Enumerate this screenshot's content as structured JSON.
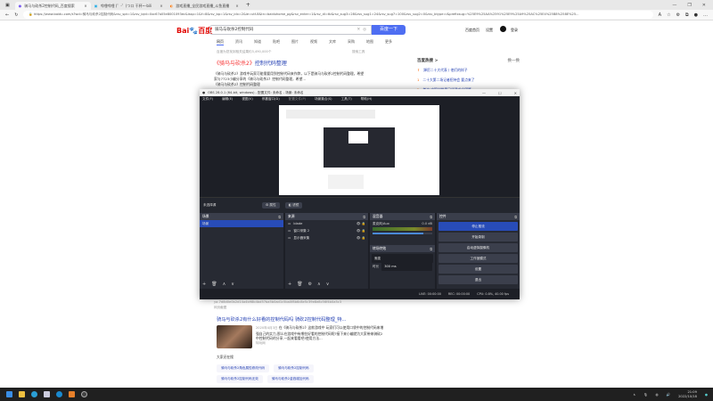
{
  "browser": {
    "tabs": [
      {
        "label": "骑马与砍杀2控制代码_百度搜索",
        "active": true
      },
      {
        "label": "哔哩哔哩 (゜-゜)つロ 干杯~-bili",
        "active": false
      },
      {
        "label": "游戏直播_全民游戏直播_斗鱼直播",
        "active": false
      }
    ],
    "new_tab": "+",
    "url": "https://www.baidu.com/s?wd=骑马与砍杀2控制代码&rsv_spt=1&rsv_iqid=0xc67a05e8001093ec&issp=1&f=8&rsv_bp=1&rsv_idx=2&ie=utf-8&tn=baiduhome_pg&rsv_enter=1&rsv_dl=tb&rsv_sug3=28&rsv_sug1=24&rsv_sug7=100&rsv_sug2=0&rsv_btype=i&prefixsug=%25E9%25AA%2591%25E9%25A9%25AC%25E4%25B8%258E%25..."
  },
  "baidu": {
    "logo": "Bai百度",
    "query": "骑马与砍杀2控制代码",
    "search_button": "百度一下",
    "top_links": [
      "百度首页",
      "设置",
      "登录"
    ],
    "nav": [
      "网页",
      "资讯",
      "知道",
      "贴吧",
      "图片",
      "视频",
      "文库",
      "采购",
      "地图",
      "更多"
    ],
    "result_count": "百度为您找到相关结果约3,490,000个",
    "search_tools": "搜索工具",
    "result1": {
      "title_a": "《骑马与砍杀2》",
      "title_b": "控制代码整理",
      "snippet": "《骑马与砍杀2》游戏中玩家可能需要用到控制代码来作弊，以下是骑马与砍杀2控制代码整理，希望",
      "snippet2": "家与7723小编分享的《骑马与砍杀2》控制代码整理，希望...",
      "snippet3": "《骑马与砍杀2》控制代码整理"
    },
    "result1_source": "ya-7d8d0e0b2d14a4b98b4bd57ba5b0ad1c5ba0f8b6c8e5c39e8e8c56f4b0a5c3",
    "screenshot_label": "网页截图",
    "result2": {
      "title": "骑马与砍杀2有什么好看的控制代码吗 骑砍2控制代码整理_特...",
      "date": "2020年4月3日",
      "snippet": "在《骑马与砍杀2》这款游戏中 玩家们可以使用口袋中的控制代码来增强自己的实力,那么在游戏中有哪些好看的控制代码呢?接下来小编就为大家带来骑砍2中控制代码的分享,一起来看看吧!使用方法...",
      "source": "特玩网"
    },
    "related_title": "大家还在搜",
    "related": [
      "骑马与砍杀2角色属性修改代码",
      "骑马与砍杀2控制代码",
      "骑马与砍杀2控制代码无效",
      "骑马与砍杀2金钱增加代码"
    ]
  },
  "hot": {
    "title": "百度热搜 >",
    "refresh": "换一换",
    "items": [
      {
        "n": "⇑",
        "t": "踔厉二十大代表丨他们的样子"
      },
      {
        "n": "1",
        "t": "二十大第二场记者招待会 要点来了"
      },
      {
        "n": "2",
        "t": "首次 中国创世界已经建成全国第一"
      }
    ]
  },
  "obs": {
    "title": "OBS 28.0.1 (64-bit, windows) - 配置文件: 未命名 - 场景: 未命名",
    "menu": [
      "文件(F)",
      "编辑(E)",
      "视图(V)",
      "停靠窗口(D)",
      "配置文件(P)",
      "场景集合(S)",
      "工具(T)",
      "帮助(H)"
    ],
    "no_source": "未选择源",
    "properties": "⚙ 属性",
    "filters": "◧ 滤镜",
    "scenes": {
      "title": "场景",
      "items": [
        "场景"
      ]
    },
    "sources": {
      "title": "来源",
      "items": [
        "blade",
        "窗口采集 2",
        "显示器采集"
      ]
    },
    "mixer": {
      "title": "混音器",
      "channel": "麦克风/Aux",
      "db": "0.0 dB",
      "level": 0.85
    },
    "transitions": {
      "title": "转场特效",
      "type": "渐变",
      "duration_label": "时长",
      "duration": "300 ms"
    },
    "controls": {
      "title": "控件",
      "buttons": [
        "停止推流",
        "开始录制",
        "启动虚拟摄像机",
        "工作室模式",
        "设置",
        "退出"
      ]
    },
    "status": {
      "live": "LIVE: 00:00:00",
      "rec": "REC: 00:00:00",
      "cpu": "CPU: 0.8%, 40.00 fps"
    }
  },
  "taskbar": {
    "time": "21:09",
    "date": "2022/10/18"
  }
}
